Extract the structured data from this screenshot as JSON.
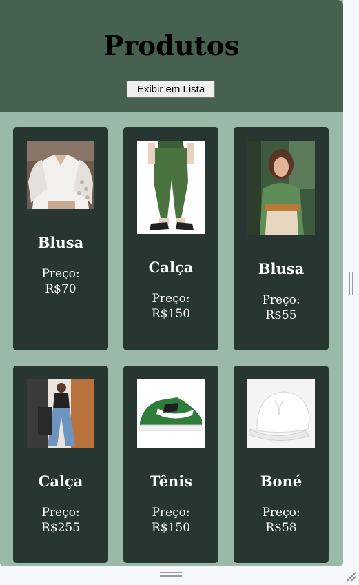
{
  "header": {
    "title": "Produtos",
    "toggle_view_label": "Exibir em Lista"
  },
  "colors": {
    "page_background": "#9ab9a9",
    "header_background": "#476150",
    "card_background": "#273631",
    "card_text": "#ffffff"
  },
  "products": [
    {
      "name": "Blusa",
      "price_label": "Preço:",
      "price": "R$70",
      "image": "white-lace-blouse-photo"
    },
    {
      "name": "Calça",
      "price_label": "Preço:",
      "price": "R$150",
      "image": "green-jogger-pants-photo"
    },
    {
      "name": "Blusa",
      "price_label": "Preço:",
      "price": "R$55",
      "image": "green-blouse-photo"
    },
    {
      "name": "Calça",
      "price_label": "Preço:",
      "price": "R$255",
      "image": "wide-leg-jeans-photo"
    },
    {
      "name": "Tênis",
      "price_label": "Preço:",
      "price": "R$150",
      "image": "green-sneaker-photo"
    },
    {
      "name": "Boné",
      "price_label": "Preço:",
      "price": "R$58",
      "image": "white-cap-photo"
    }
  ]
}
